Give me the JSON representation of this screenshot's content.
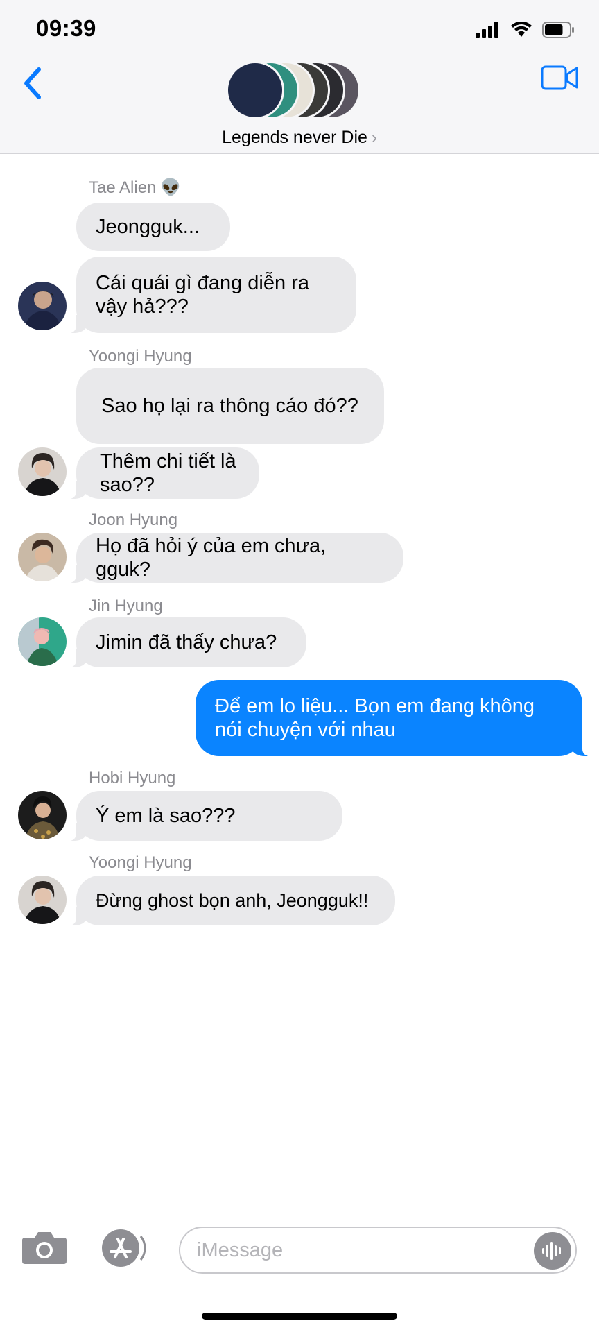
{
  "status_bar": {
    "time": "09:39",
    "icons": [
      "signal-icon",
      "wifi-icon",
      "battery-icon"
    ],
    "battery_level": 0.75
  },
  "header": {
    "back_icon": "chevron-left-icon",
    "video_icon": "video-camera-icon",
    "group_title": "Legends never Die",
    "chevron": "›",
    "avatar_colors": [
      "#1f2a48",
      "#2f8f7f",
      "#e7e2d8",
      "#3a3a38",
      "#2b2b30",
      "#5a5560"
    ]
  },
  "messages": [
    {
      "sender": "Tae Alien",
      "sender_emoji": "👽",
      "text": "Jeongguk...",
      "avatar": "",
      "direction": "in"
    },
    {
      "sender": "",
      "text": "Cái quái gì đang diễn ra vậy hả???",
      "avatar": "tae-avatar",
      "direction": "in"
    },
    {
      "sender": "Yoongi Hyung",
      "text": "Sao họ lại ra thông cáo đó??",
      "avatar": "",
      "direction": "in"
    },
    {
      "sender": "",
      "text": "Thêm chi tiết là sao??",
      "avatar": "yoongi-avatar",
      "direction": "in"
    },
    {
      "sender": "Joon Hyung",
      "text": "Họ đã hỏi ý của em chưa, gguk?",
      "avatar": "joon-avatar",
      "direction": "in"
    },
    {
      "sender": "Jin Hyung",
      "text": "Jimin đã thấy chưa?",
      "avatar": "jin-avatar",
      "direction": "in"
    },
    {
      "sender": "",
      "text": "Để em lo liệu... Bọn em đang không nói chuyện với nhau",
      "avatar": "",
      "direction": "out"
    },
    {
      "sender": "Hobi Hyung",
      "text": "Ý em là sao???",
      "avatar": "hobi-avatar",
      "direction": "in"
    },
    {
      "sender": "Yoongi Hyung",
      "text": "Đừng ghost bọn anh, Jeongguk!!",
      "avatar": "yoongi-avatar",
      "direction": "in"
    }
  ],
  "colors": {
    "incoming_bubble": "#e9e9eb",
    "outgoing_bubble": "#0a84ff",
    "accent": "#0a7aff"
  },
  "composer": {
    "camera_icon": "camera-icon",
    "appstore_icon": "app-store-icon",
    "placeholder": "iMessage",
    "value": "",
    "audio_icon": "audio-waveform-icon"
  }
}
